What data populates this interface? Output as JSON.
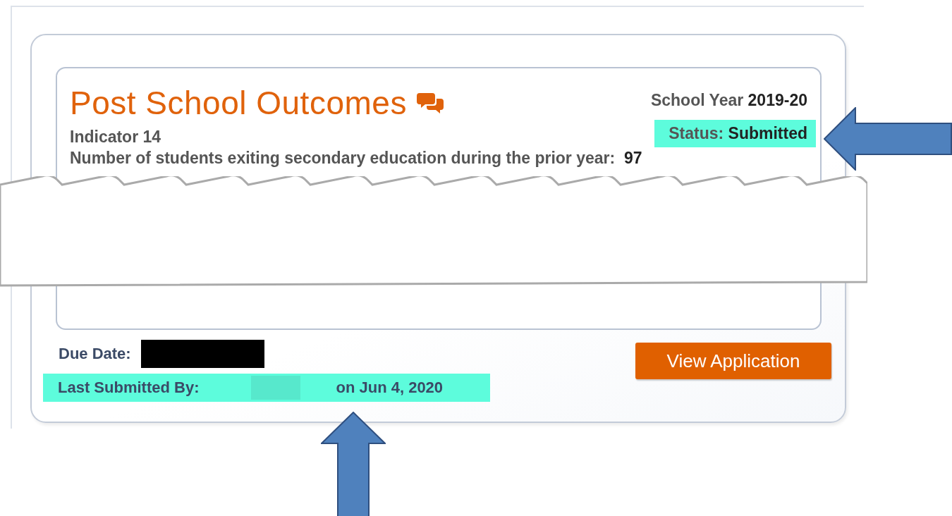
{
  "card": {
    "title": "Post School Outcomes",
    "subtitle": "Indicator 14",
    "school_year_label": "School Year",
    "school_year": "2019-20",
    "status_label": "Status:",
    "status": "Submitted",
    "status_highlighted": true,
    "exiting_label": "Number of students exiting secondary education during the prior year:",
    "exiting_count": "97"
  },
  "footer": {
    "due_date_label": "Due Date:",
    "last_submitted_label": "Last Submitted By:",
    "last_submitted_tail": "on Jun 4, 2020",
    "highlighted": true
  },
  "button": {
    "label": "View Application"
  }
}
